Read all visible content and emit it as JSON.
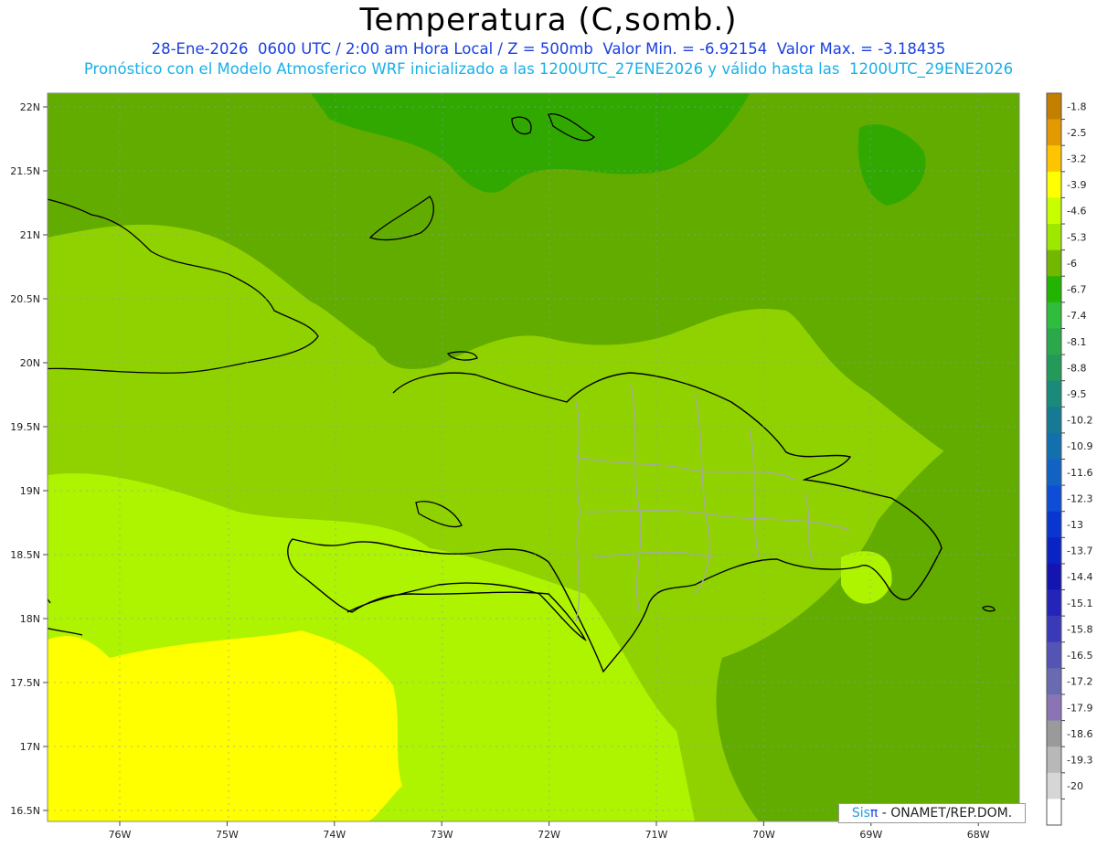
{
  "title": "Temperatura (C,somb.)",
  "subtitle_1": "28-Ene-2026  0600 UTC / 2:00 am Hora Local / Z = 500mb  Valor Min. = -6.92154  Valor Max. = -3.18435",
  "subtitle_2": "Pronóstico con el Modelo Atmosferico WRF inicializado a las 1200UTC_27ENE2026 y válido hasta las  1200UTC_29ENE2026",
  "credit": {
    "sis": "Sis",
    "pi": "π",
    "rest": " - ONAMET/REP.DOM."
  },
  "lat_labels": [
    "22N",
    "21.5N",
    "21N",
    "20.5N",
    "20N",
    "19.5N",
    "19N",
    "18.5N",
    "18N",
    "17.5N",
    "17N",
    "16.5N"
  ],
  "lon_labels": [
    "76W",
    "75W",
    "74W",
    "73W",
    "72W",
    "71W",
    "70W",
    "69W",
    "68W"
  ],
  "colorbar": {
    "labels": [
      "-1.8",
      "-2.5",
      "-3.2",
      "-3.9",
      "-4.6",
      "-5.3",
      "-6",
      "-6.7",
      "-7.4",
      "-8.1",
      "-8.8",
      "-9.5",
      "-10.2",
      "-10.9",
      "-11.6",
      "-12.3",
      "-13",
      "-13.7",
      "-14.4",
      "-15.1",
      "-15.8",
      "-16.5",
      "-17.2",
      "-17.9",
      "-18.6",
      "-19.3",
      "-20"
    ],
    "colors": [
      "#c47f00",
      "#e39a00",
      "#ffc400",
      "#ffff00",
      "#c8ff00",
      "#9ee800",
      "#72b800",
      "#22b400",
      "#30bc3c",
      "#2aa84a",
      "#249a5a",
      "#1a8a7a",
      "#167a94",
      "#1270ae",
      "#1262c4",
      "#0e4ed6",
      "#0a36d0",
      "#0a24c4",
      "#1414b0",
      "#2424b8",
      "#3a3ab8",
      "#5454b4",
      "#6a6ab0",
      "#8a74b4",
      "#9a9a9a",
      "#b8b8b8",
      "#d6d6d6",
      "#ffffff"
    ]
  },
  "colors": {
    "band_dark": "#31a800",
    "band_mid": "#62ac00",
    "band_light": "#8fd200",
    "band_lime": "#aef400",
    "band_yellow": "#ffff00",
    "coast": "#000000",
    "provinces": "#a8a8a8",
    "grid": "#8899cc"
  }
}
